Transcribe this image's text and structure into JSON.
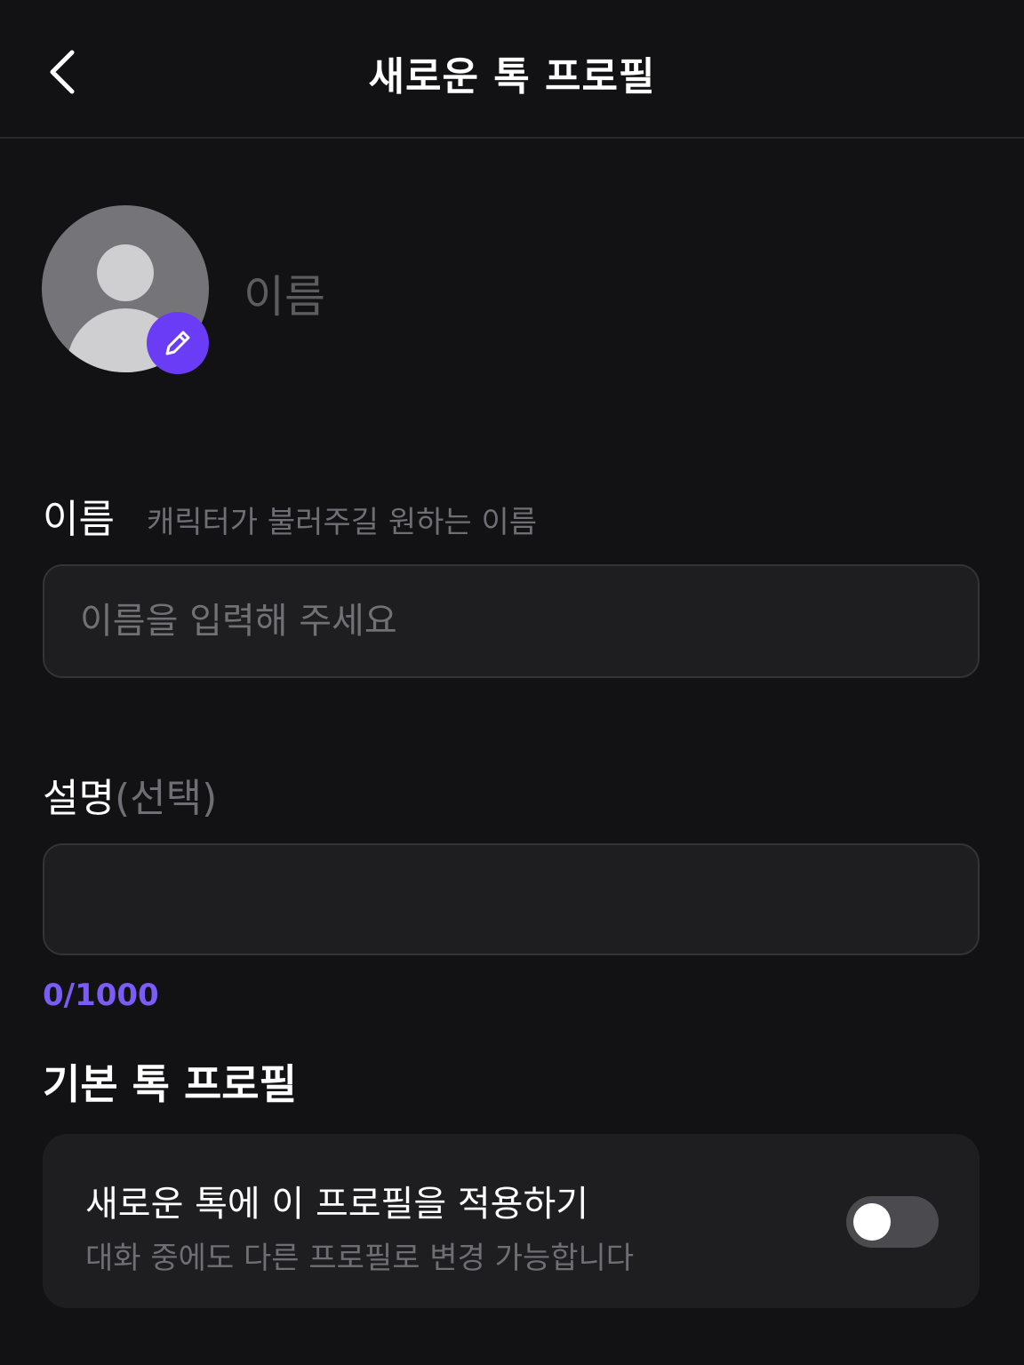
{
  "header": {
    "title": "새로운 톡 프로필",
    "back_icon": "chevron-left-icon"
  },
  "profile": {
    "name_display": "이름",
    "avatar_icon": "default-user-avatar",
    "edit_icon": "pencil-icon"
  },
  "name_field": {
    "label": "이름",
    "hint": "캐릭터가 불러주길 원하는 이름",
    "placeholder": "이름을 입력해 주세요",
    "value": ""
  },
  "description_field": {
    "label": "설명",
    "optional": "(선택)",
    "value": "",
    "counter": "0/1000"
  },
  "default_profile": {
    "section_title": "기본 톡 프로필",
    "setting_title": "새로운 톡에 이 프로필을 적용하기",
    "setting_desc": "대화 중에도 다른 프로필로 변경 가능합니다",
    "toggle_on": false
  },
  "colors": {
    "accent": "#6a3cf5",
    "counter": "#7b5cf7",
    "background": "#121214",
    "card": "#1e1e21"
  }
}
